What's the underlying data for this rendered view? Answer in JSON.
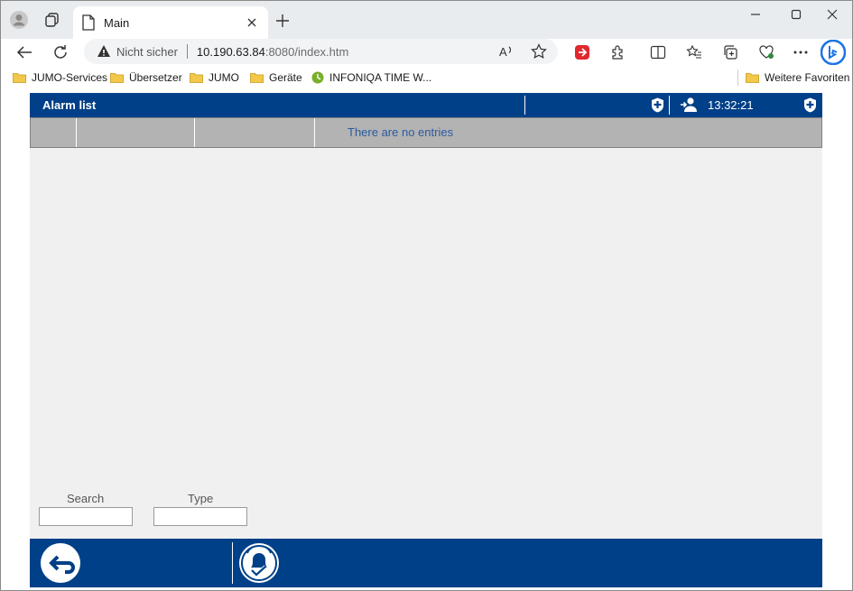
{
  "browser": {
    "tab_title": "Main",
    "url_warning": "Nicht sicher",
    "url_host": "10.190.63.84",
    "url_path": ":8080/index.htm",
    "bookmarks": [
      {
        "label": "JUMO-Services",
        "icon": "folder-icon"
      },
      {
        "label": "Übersetzer",
        "icon": "folder-icon"
      },
      {
        "label": "JUMO",
        "icon": "folder-icon"
      },
      {
        "label": "Geräte",
        "icon": "folder-icon"
      },
      {
        "label": "INFONIQA TIME W...",
        "icon": "clock-icon"
      }
    ],
    "other_favorites": "Weitere Favoriten"
  },
  "app": {
    "title": "Alarm list",
    "time": "13:32:21",
    "empty_message": "There are no entries",
    "filters": {
      "search_label": "Search",
      "type_label": "Type",
      "search_value": "",
      "type_value": ""
    },
    "colors": {
      "header_blue": "#004088",
      "table_head_gray": "#b3b3b3",
      "body_bg": "#f0f0f0",
      "empty_text": "#2b5aa0"
    }
  }
}
